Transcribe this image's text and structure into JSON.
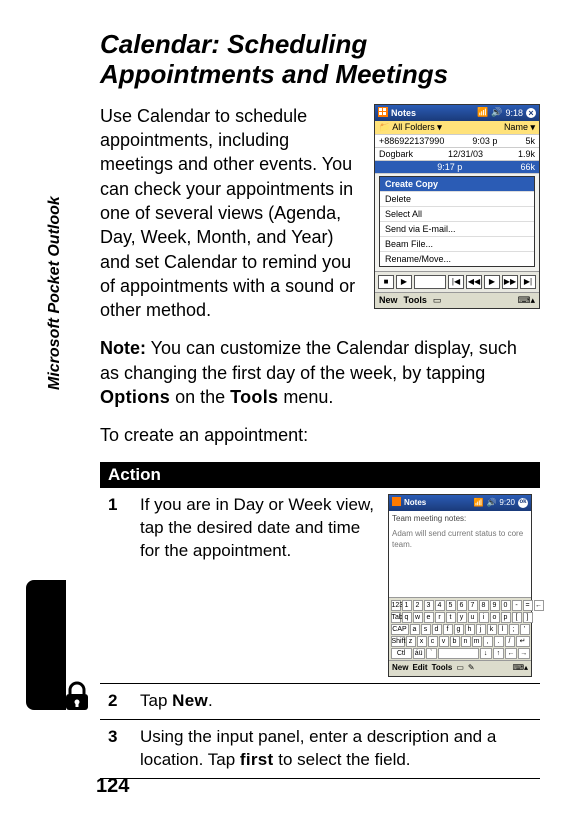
{
  "page_number": "124",
  "side_label": "Microsoft Pocket Outlook",
  "title": "Calendar: Scheduling Appointments and Meetings",
  "intro": "Use Calendar to schedule appointments, including meetings and other events. You can check your appointments in one of several views (Agenda, Day, Week, Month, and Year) and set Calendar to remind you of appointments with a sound or other method.",
  "note_label": "Note:",
  "note_before": " You can customize the Calendar display, such as changing the first day of the week, by tapping ",
  "note_bold1": "Options",
  "note_mid": " on the ",
  "note_bold2": "Tools",
  "note_after": " menu.",
  "lead_in": "To create an appointment:",
  "table_header": "Action",
  "step1_num": "1",
  "step1_text": "If you are in Day or Week view, tap the desired date and time for the appointment.",
  "step2_num": "2",
  "step2_before": "Tap ",
  "step2_bold": "New",
  "step2_after": ".",
  "step3_num": "3",
  "step3_before": "Using the input panel, enter a description and a location. Tap ",
  "step3_bold": "first",
  "step3_after": " to select the field.",
  "shot1": {
    "app": "Notes",
    "time": "9:18",
    "folder_label": "All Folders",
    "col_name": "Name",
    "row1_a": "+886922137990",
    "row1_b": "9:03 p",
    "row1_c": "5k",
    "row2_a": "Dogbark",
    "row2_b": "12/31/03",
    "row2_c": "1.9k",
    "row3_a": "",
    "row3_b": "9:17 p",
    "row3_c": "66k",
    "menu_title": "Create Copy",
    "menu_items": [
      "Delete",
      "Select All",
      "Send via E-mail...",
      "Beam File...",
      "Rename/Move..."
    ],
    "soft_new": "New",
    "soft_tools": "Tools"
  },
  "shot2": {
    "app": "Notes",
    "time": "9:20",
    "heading": "Team meeting notes:",
    "body": "Adam will send current status to core team.",
    "kbd_rows": [
      [
        "123",
        "1",
        "2",
        "3",
        "4",
        "5",
        "6",
        "7",
        "8",
        "9",
        "0",
        "-",
        "=",
        "←"
      ],
      [
        "Tab",
        "q",
        "w",
        "e",
        "r",
        "t",
        "y",
        "u",
        "i",
        "o",
        "p",
        "[",
        "]"
      ],
      [
        "CAP",
        "a",
        "s",
        "d",
        "f",
        "g",
        "h",
        "j",
        "k",
        "l",
        ";",
        "'"
      ],
      [
        "Shift",
        "z",
        "x",
        "c",
        "v",
        "b",
        "n",
        "m",
        ",",
        ".",
        "/",
        "↵"
      ],
      [
        "Ctl",
        "áü",
        "`",
        "",
        "",
        "",
        "",
        "",
        "↓",
        "↑",
        "←",
        "→"
      ]
    ],
    "soft_new": "New",
    "soft_edit": "Edit",
    "soft_tools": "Tools"
  }
}
